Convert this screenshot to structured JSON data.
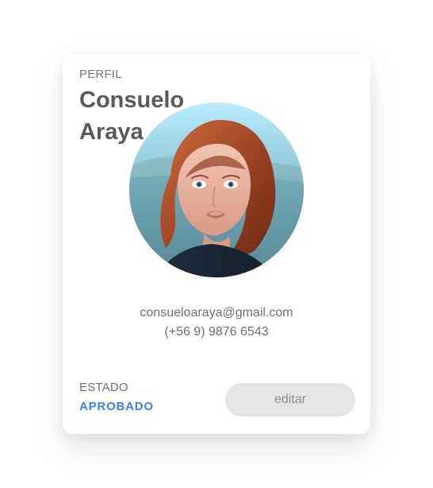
{
  "profile": {
    "eyebrow": "PERFIL",
    "first_name": "Consuelo",
    "last_name": "Araya",
    "avatar_icon": "avatar-photo",
    "email": "consueloaraya@gmail.com",
    "phone": "(+56 9) 9876 6543"
  },
  "status": {
    "label": "ESTADO",
    "value": "APROBADO",
    "value_color": "#3b82f6"
  },
  "actions": {
    "edit_label": "editar"
  }
}
